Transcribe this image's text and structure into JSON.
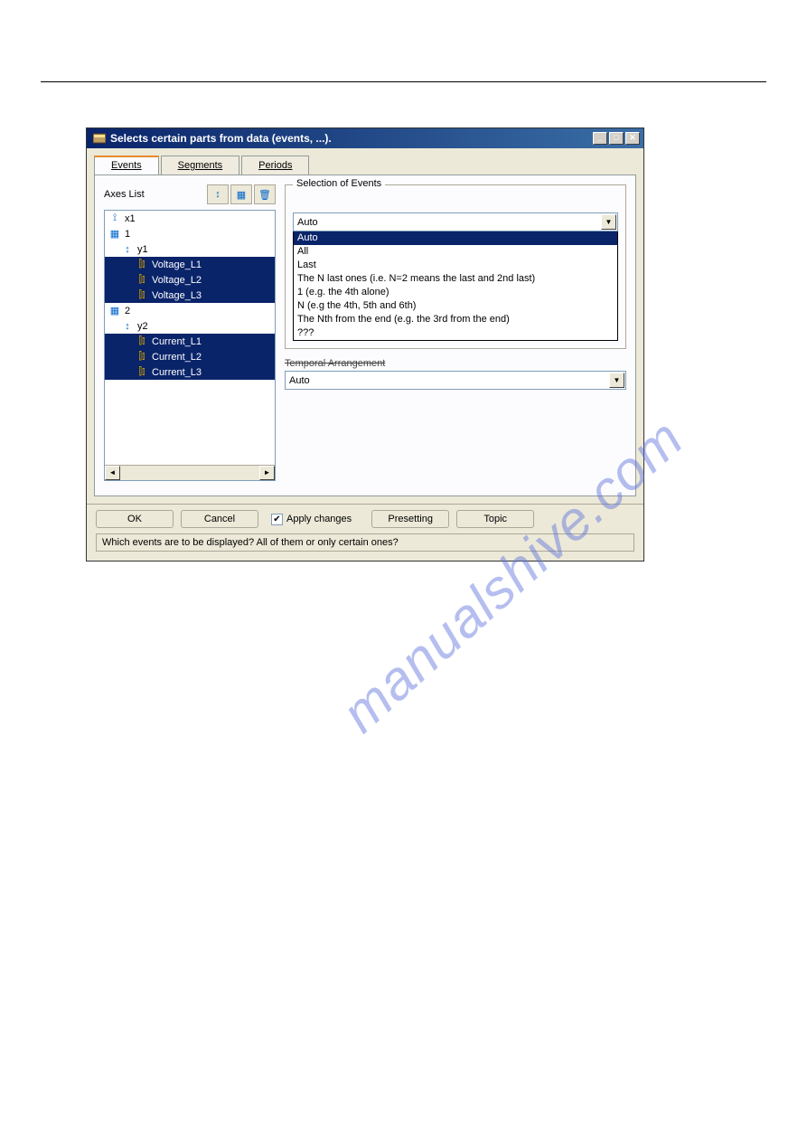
{
  "titlebar": {
    "text": "Selects certain parts from data (events, ...)."
  },
  "tabs": {
    "events": "Events",
    "segments": "Segments",
    "periods": "Periods"
  },
  "axes": {
    "label": "Axes List",
    "items": {
      "x1": "x1",
      "g1": "1",
      "y1": "y1",
      "vl1": "Voltage_L1",
      "vl2": "Voltage_L2",
      "vl3": "Voltage_L3",
      "g2": "2",
      "y2": "y2",
      "cl1": "Current_L1",
      "cl2": "Current_L2",
      "cl3": "Current_L3"
    }
  },
  "selection": {
    "legend": "Selection of Events",
    "value": "Auto",
    "options": {
      "o0": "Auto",
      "o1": "All",
      "o2": "Last",
      "o3": "The N last ones (i.e. N=2 means the last and 2nd last)",
      "o4": "1   (e.g. the 4th alone)",
      "o5": "N  (e.g the 4th, 5th and 6th)",
      "o6": "The Nth from the end (e.g. the 3rd from the end)",
      "o7": "???"
    }
  },
  "temporal": {
    "label": "Temporal Arrangement",
    "value": "Auto"
  },
  "buttons": {
    "ok": "OK",
    "cancel": "Cancel",
    "apply": "Apply changes",
    "presetting": "Presetting",
    "topic": "Topic"
  },
  "status": "Which events are to be displayed? All of them or only certain ones?",
  "watermark": "manualshive.com"
}
